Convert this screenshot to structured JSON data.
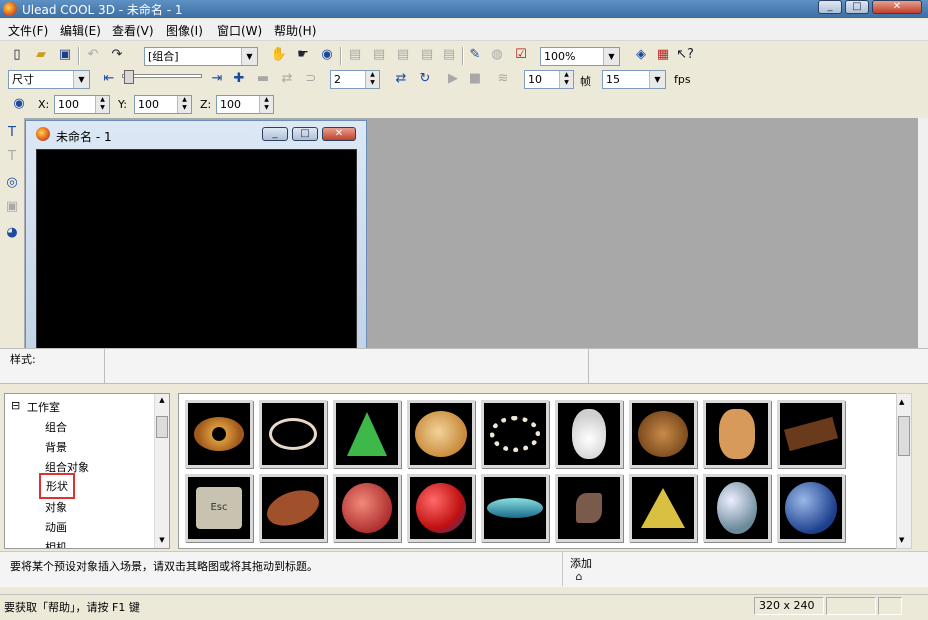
{
  "window": {
    "title": "Ulead COOL 3D - 未命名 - 1"
  },
  "menu": [
    "文件(F)",
    "编辑(E)",
    "查看(V)",
    "图像(I)",
    "窗口(W)",
    "帮助(H)"
  ],
  "toolbar1": {
    "object_combo": "[组合]",
    "zoom_combo": "100%"
  },
  "toolbar2": {
    "size_combo": "尺寸",
    "frame_value": "2",
    "frame_count": "10",
    "frame_label": "帧",
    "fps_value": "15",
    "fps_label": "fps"
  },
  "toolbar3": {
    "x_label": "X:",
    "x_value": "100",
    "y_label": "Y:",
    "y_value": "100",
    "z_label": "Z:",
    "z_value": "100"
  },
  "document_window": {
    "title": "未命名 - 1"
  },
  "style_bar": {
    "label": "样式:"
  },
  "tree": {
    "root": "工作室",
    "items": [
      "组合",
      "背景",
      "组合对象",
      "形状",
      "对象",
      "动画",
      "相机"
    ],
    "selected": "形状",
    "highlight_color": "#e03030"
  },
  "gallery": {
    "items": [
      "donut",
      "ring",
      "cone",
      "swirl-bun",
      "pearl-necklace",
      "snowman",
      "bear",
      "gingerbread",
      "chocolate-bar",
      "esc-key",
      "football",
      "basketball",
      "ball",
      "spinning-top",
      "seashell",
      "face-pyramid",
      "egg",
      "earth-globe"
    ]
  },
  "info": {
    "message": "要将某个预设对象插入场景，请双击其略图或将其拖动到标题。",
    "add_label": "添加"
  },
  "status": {
    "help": "要获取「帮助」，请按 F1 键",
    "dims": "320 x 240"
  }
}
